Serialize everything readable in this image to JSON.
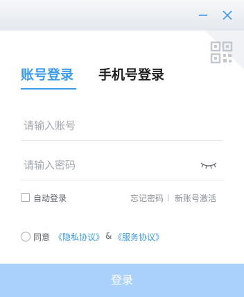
{
  "window": {
    "minimize_icon": "minimize-icon",
    "close_icon": "close-icon"
  },
  "qr_switch": {
    "icon": "qr-code-icon"
  },
  "tabs": {
    "account_label": "账号登录",
    "phone_label": "手机号登录",
    "active": "account"
  },
  "form": {
    "account": {
      "placeholder": "请输入账号",
      "value": ""
    },
    "password": {
      "placeholder": "请输入密码",
      "value": "",
      "toggle_icon": "eye-closed-icon"
    }
  },
  "options": {
    "auto_login_label": "自动登录",
    "auto_login_checked": false,
    "forgot_label": "忘记密码",
    "register_label": "新账号激活"
  },
  "agreement": {
    "agree_label": "同意",
    "privacy_label": "《隐私协议》",
    "amp": "&",
    "service_label": "《服务协议》",
    "agreed": false
  },
  "login_label": "登录",
  "colors": {
    "accent": "#3c9ae8",
    "login_button_disabled": "#a9d1fb",
    "titlebar": "#e3e7ed"
  }
}
